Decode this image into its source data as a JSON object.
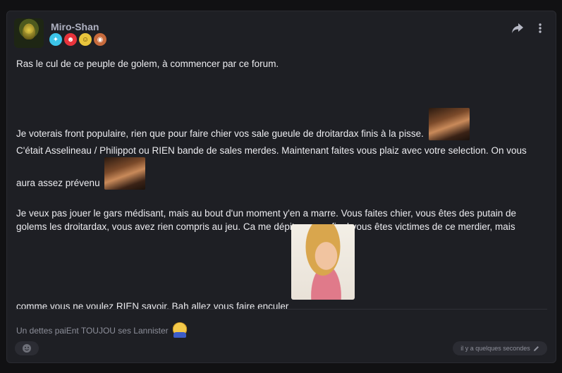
{
  "post": {
    "username": "Miro-Shan",
    "badges": [
      {
        "name": "diamond-badge",
        "symbol": "✦"
      },
      {
        "name": "red-face-badge",
        "symbol": "☻"
      },
      {
        "name": "yellow-face-badge",
        "symbol": "☺"
      },
      {
        "name": "pig-badge",
        "symbol": "◉"
      }
    ],
    "paragraphs": {
      "p1": "Ras le cul de ce peuple de golem, à commencer par ce forum.",
      "p2": "Je voterais front populaire, rien que pour faire chier vos sale gueule de droitardax finis à la pisse.",
      "p3_line1": "C'était Asselineau / Philippot ou RIEN bande de sales merdes. Maintenant faites vous plaiz avec votre selection. On vous",
      "p3_line2": "aura assez prévenu",
      "p4_line1": "Je veux pas jouer le gars médisant, mais au bout d'un moment y'en a marre. Vous faites chier, vous êtes des putain de",
      "p4_line2": "golems les droitardax, vous avez rien compris au jeu. Ca me dépite car au final vous êtes victimes de ce merdier, mais",
      "p4_line3": "comme vous ne voulez RIEN savoir. Bah allez vous faire enculer"
    },
    "signature": "Un dettes paiEnt TOUJOU ses Lannister",
    "timestamp": "il y a quelques secondes"
  },
  "icons": {
    "share": "share-icon",
    "more": "more-vertical-icon",
    "reaction": "add-reaction-icon",
    "edit": "pencil-icon"
  },
  "colors": {
    "background": "#111113",
    "card": "#1e1f24",
    "username": "#aeb0c0",
    "text": "#ececf0",
    "muted": "#8d8f9a"
  }
}
